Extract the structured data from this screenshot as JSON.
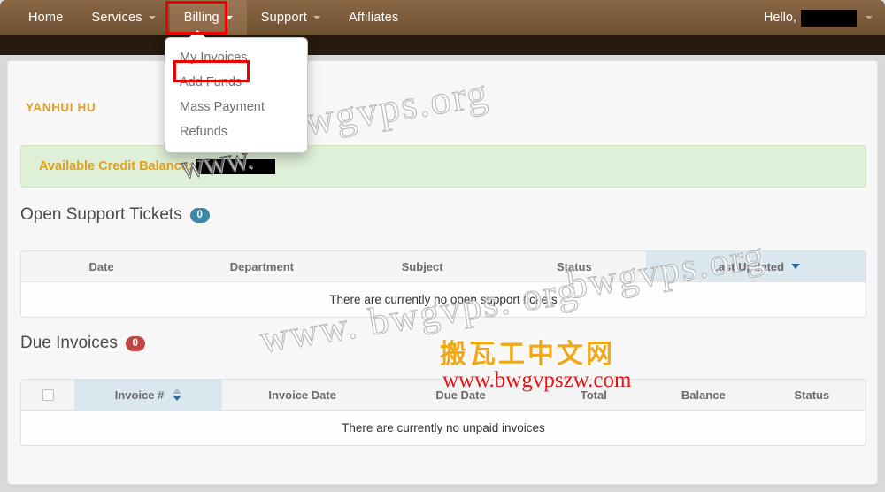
{
  "navbar": {
    "items": [
      {
        "label": "Home",
        "has_caret": false,
        "active": false
      },
      {
        "label": "Services",
        "has_caret": true,
        "active": false
      },
      {
        "label": "Billing",
        "has_caret": true,
        "active": true
      },
      {
        "label": "Support",
        "has_caret": true,
        "active": false
      },
      {
        "label": "Affiliates",
        "has_caret": false,
        "active": false
      }
    ],
    "greeting": "Hello,",
    "account_name_redacted": true
  },
  "dropdown": {
    "parent": "Billing",
    "items": [
      {
        "label": "My Invoices",
        "highlighted": false
      },
      {
        "label": "Add Funds",
        "highlighted": true
      },
      {
        "label": "Mass Payment",
        "highlighted": false
      },
      {
        "label": "Refunds",
        "highlighted": false
      }
    ]
  },
  "page": {
    "username": "YANHUI HU",
    "credit_balance_label": "Available Credit Balance:",
    "credit_balance_value_redacted": true
  },
  "support_tickets": {
    "title": "Open Support Tickets",
    "count": "0",
    "columns": [
      "Date",
      "Department",
      "Subject",
      "Status",
      "Last Updated"
    ],
    "sorted_column": "Last Updated",
    "sort_direction": "desc",
    "empty_message": "There are currently no open support tickets"
  },
  "due_invoices": {
    "title": "Due Invoices",
    "count": "0",
    "columns": [
      "Invoice #",
      "Invoice Date",
      "Due Date",
      "Total",
      "Balance",
      "Status"
    ],
    "has_select_all_checkbox": true,
    "sorted_column": "Invoice #",
    "sort_direction": "desc",
    "empty_message": "There are currently no unpaid invoices"
  },
  "watermarks": {
    "outline_1": "bwgvps.org",
    "outline_2": "bwgvps.org",
    "outline_3": "www. bwgvps. org",
    "www_black_box": "WWW.",
    "chinese": "搬瓦工中文网",
    "url": "www.bwgvpszw.com"
  },
  "colors": {
    "navbar": "#7a5a3a",
    "navbar_strip": "#271a0c",
    "page_bg": "#d9d9d9",
    "accent_orange": "#e0a020",
    "alert_green_bg": "#dff0d8",
    "badge_teal": "#3d88a8",
    "badge_red": "#c14343",
    "sorted_col_bg": "#dbe7ef",
    "annotation_red": "#ee0000",
    "watermark_red": "#e81414",
    "watermark_orange": "#f0a81a"
  }
}
